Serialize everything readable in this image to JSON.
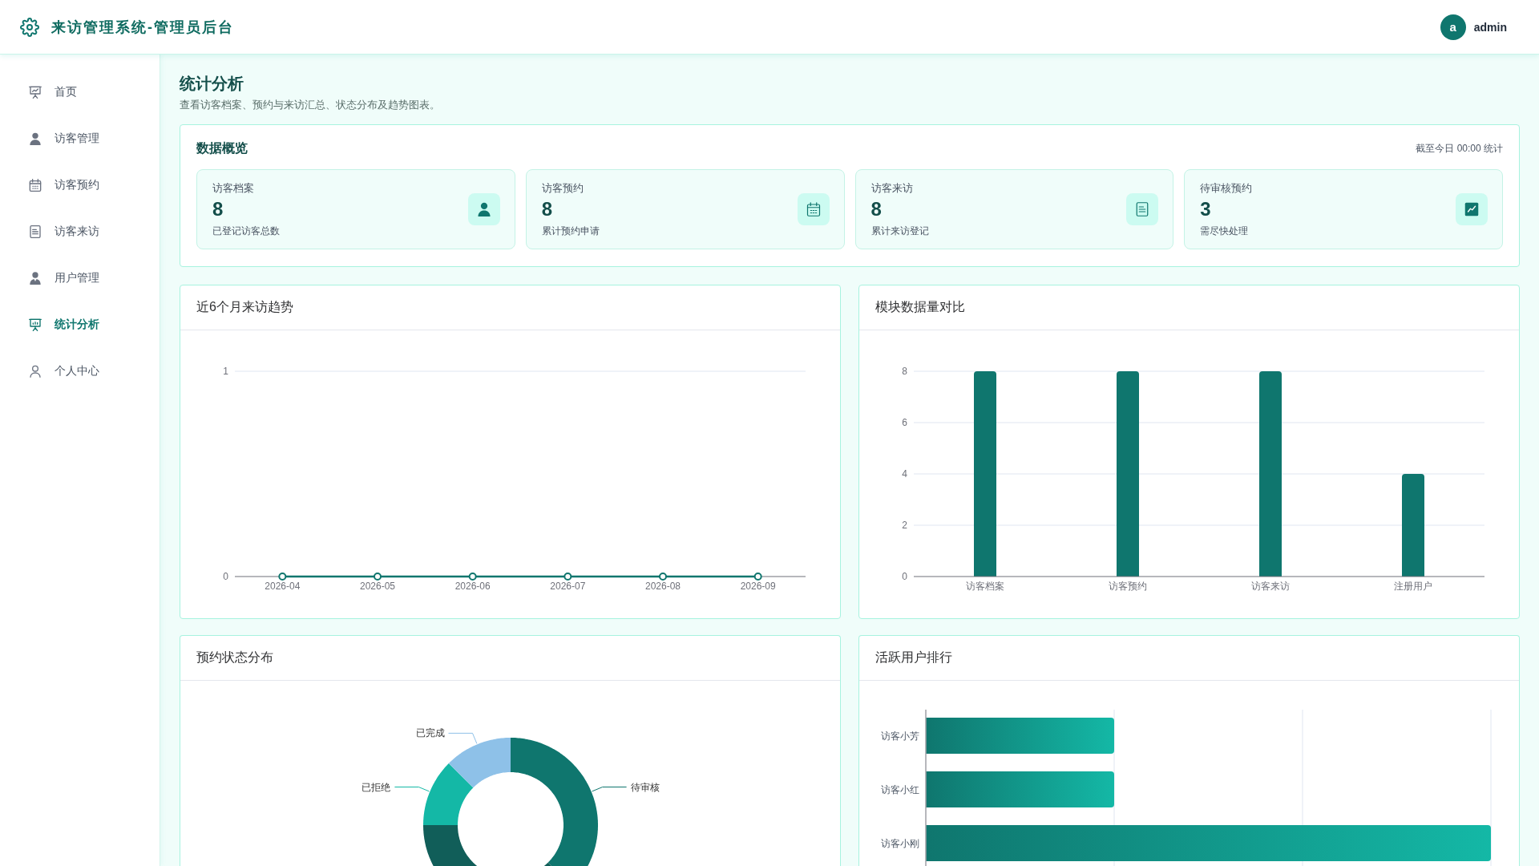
{
  "header": {
    "title": "来访管理系统-管理员后台",
    "user": {
      "avatar": "a",
      "name": "admin"
    }
  },
  "sidebar": {
    "items": [
      {
        "label": "首页",
        "selected": false
      },
      {
        "label": "访客管理",
        "selected": false
      },
      {
        "label": "访客预约",
        "selected": false
      },
      {
        "label": "访客来访",
        "selected": false
      },
      {
        "label": "用户管理",
        "selected": false
      },
      {
        "label": "统计分析",
        "selected": true
      },
      {
        "label": "个人中心",
        "selected": false
      }
    ]
  },
  "page": {
    "title": "统计分析",
    "subtitle": "查看访客档案、预约与来访汇总、状态分布及趋势图表。"
  },
  "overview": {
    "title": "数据概览",
    "note": "截至今日 00:00 统计",
    "cards": [
      {
        "label": "访客档案",
        "value": "8",
        "caption": "已登记访客总数"
      },
      {
        "label": "访客预约",
        "value": "8",
        "caption": "累计预约申请"
      },
      {
        "label": "访客来访",
        "value": "8",
        "caption": "累计来访登记"
      },
      {
        "label": "待审核预约",
        "value": "3",
        "caption": "需尽快处理"
      }
    ]
  },
  "trend": {
    "chart_data": {
      "type": "line",
      "title": "近6个月来访趋势",
      "categories": [
        "2026-04",
        "2026-05",
        "2026-06",
        "2026-07",
        "2026-08",
        "2026-09"
      ],
      "series": [
        {
          "color": "#0f766e",
          "marker": true,
          "values": [
            0,
            0,
            0,
            0,
            0,
            0
          ]
        }
      ],
      "ylim": [
        0,
        1
      ],
      "yticks": [
        0,
        1
      ],
      "grid": true
    }
  },
  "module_compare": {
    "chart_data": {
      "type": "bar",
      "title": "模块数据量对比",
      "categories": [
        "访客档案",
        "访客预约",
        "访客来访",
        "注册用户"
      ],
      "series": [
        {
          "color": "#0f766e",
          "values": [
            8,
            8,
            8,
            4
          ]
        }
      ],
      "ylim": [
        0,
        8
      ],
      "yticks": [
        0,
        2,
        4,
        6,
        8
      ],
      "grid": true
    }
  },
  "status_distribution": {
    "title": "预约状态分布",
    "slices": [
      {
        "label": "待审核",
        "color": "#0f766e"
      },
      {
        "color": "#115e59"
      },
      {
        "label": "已拒绝",
        "color": "#14b8a6"
      },
      {
        "label": "已完成",
        "color": "#8ec1e8"
      }
    ]
  },
  "active_users": {
    "title": "活跃用户排行",
    "users": [
      {
        "name": "访客小芳"
      },
      {
        "name": "访客小红"
      },
      {
        "name": "访客小刚"
      }
    ]
  }
}
